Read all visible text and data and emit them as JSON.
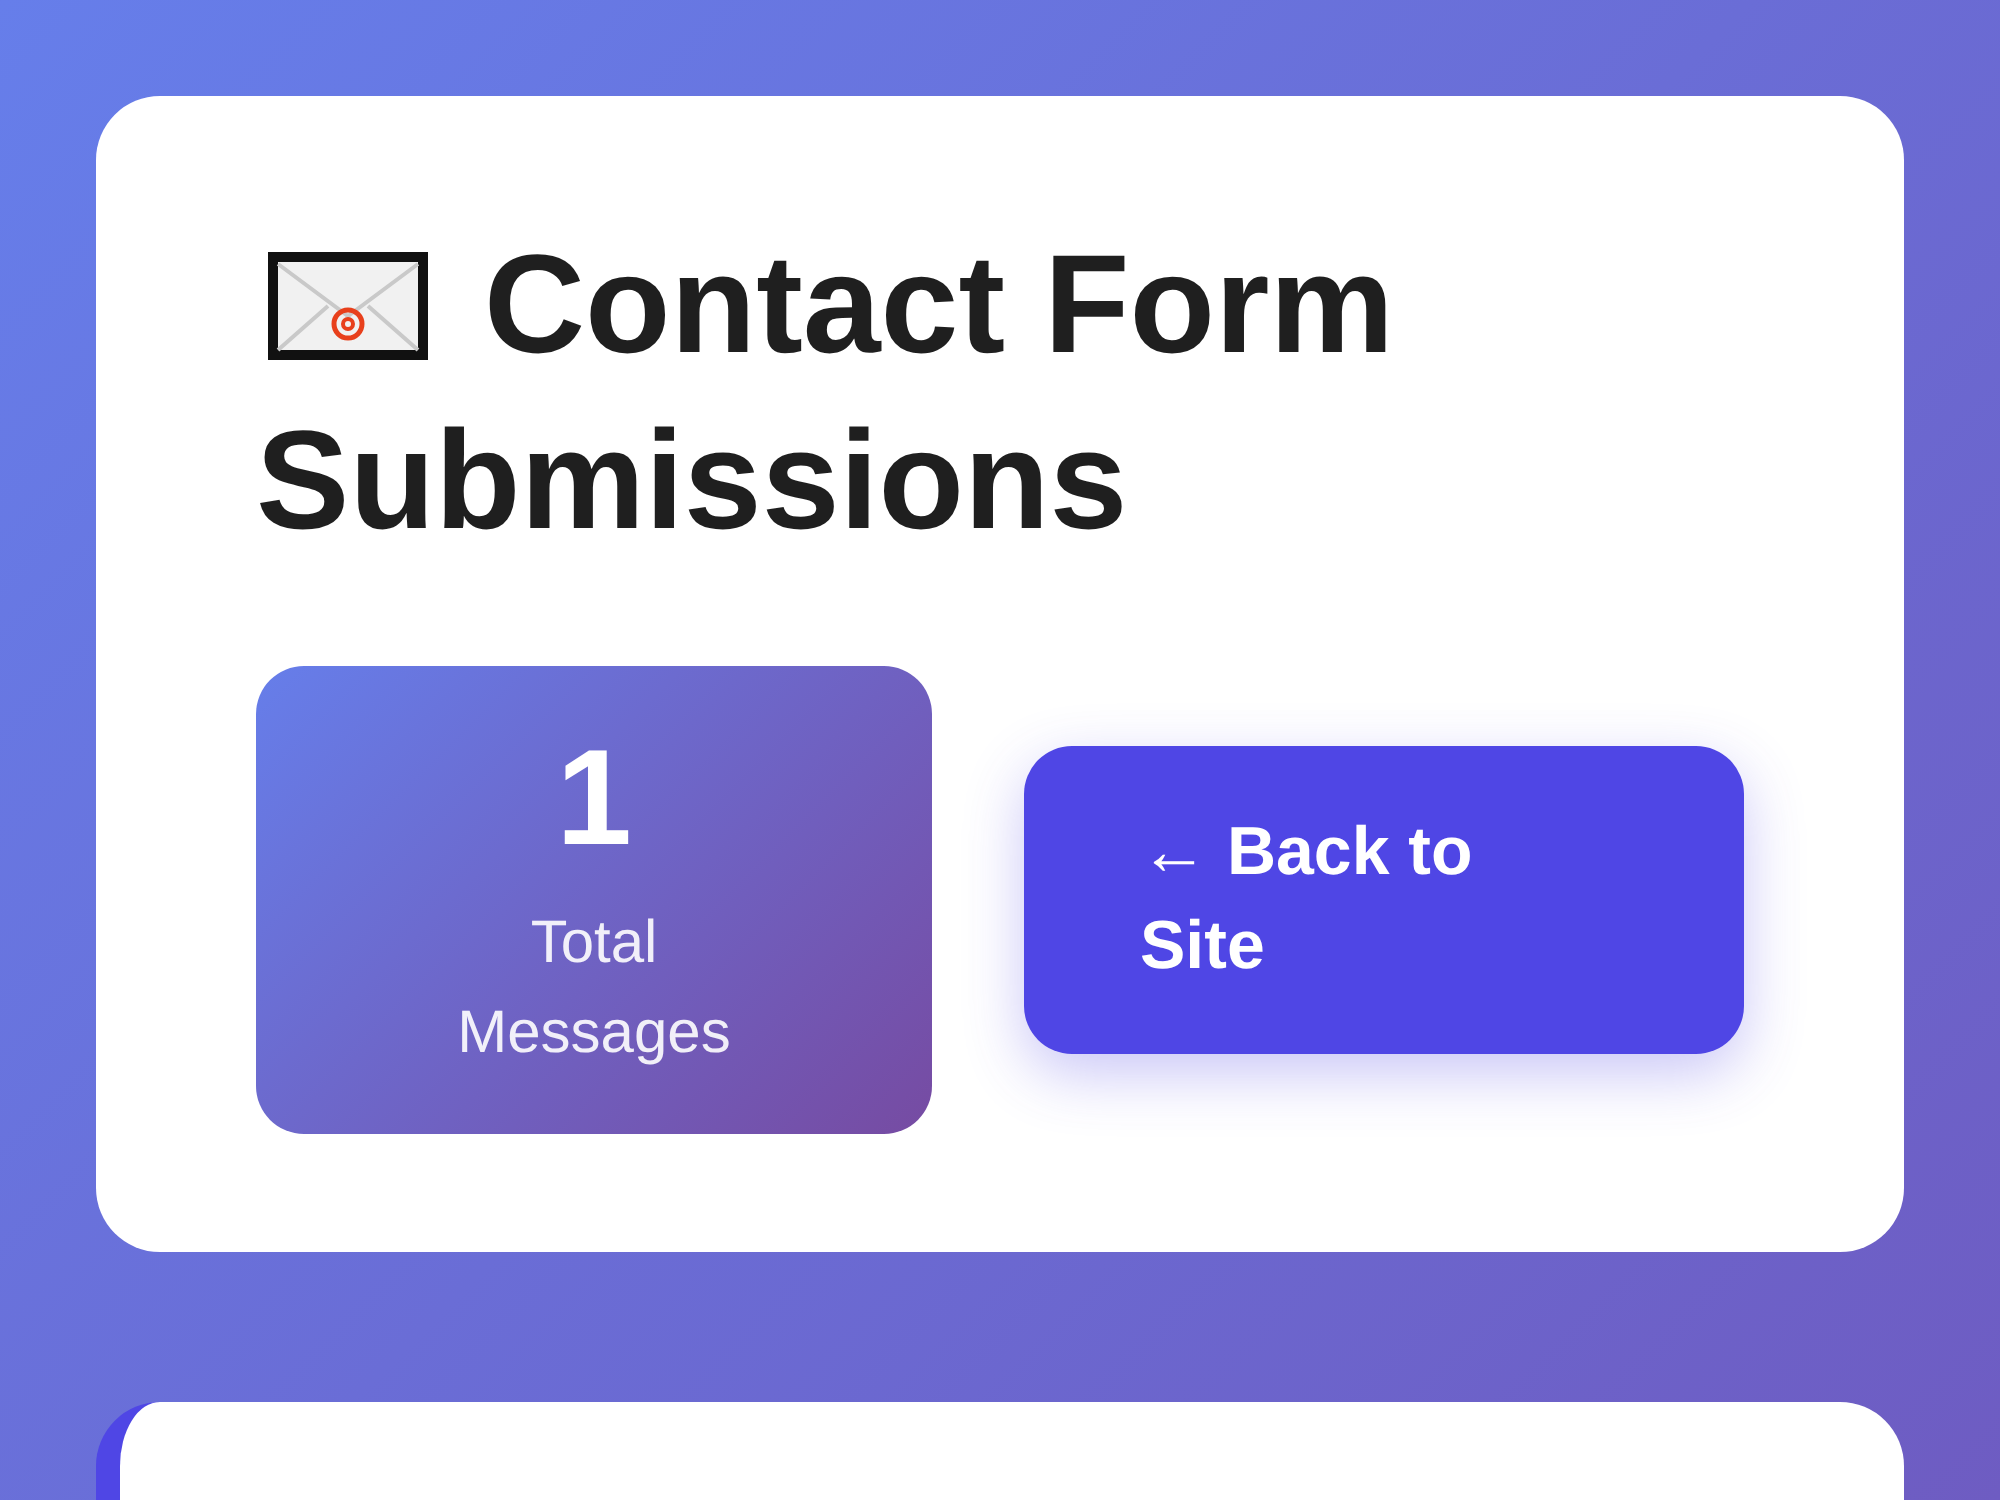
{
  "header": {
    "title_lines": [
      "Contact Form",
      "Submissions"
    ]
  },
  "stats": [
    {
      "value": "1",
      "label": "Total Messages"
    }
  ],
  "back_button": {
    "label": "← Back to Site"
  }
}
